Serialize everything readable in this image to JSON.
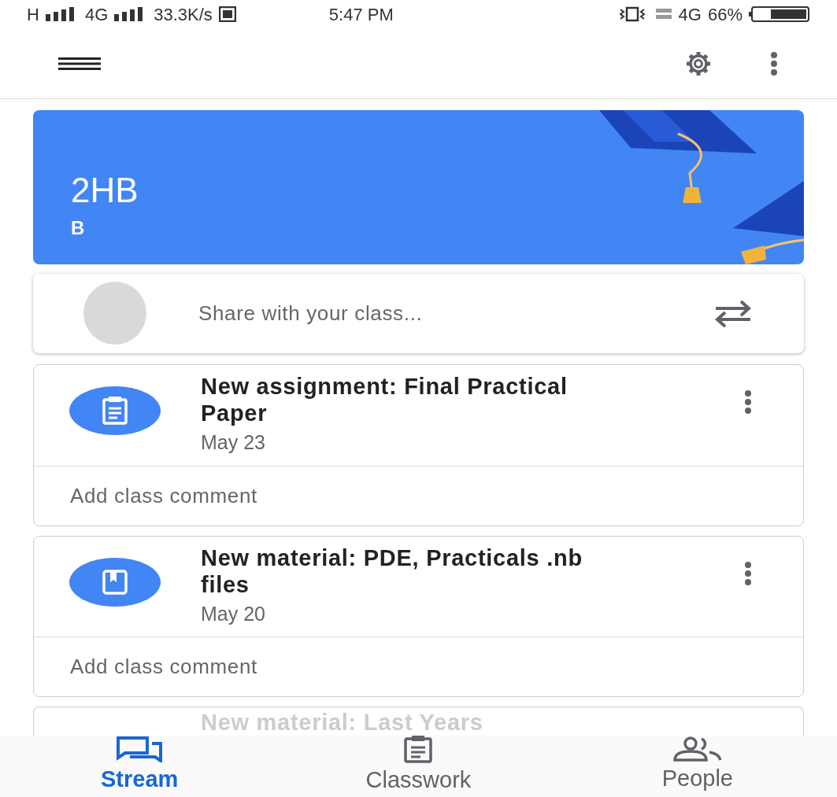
{
  "status_bar": {
    "network_1": "H",
    "network_2": "4G",
    "speed": "33.3K/s",
    "time": "5:47 PM",
    "network_3": "4G",
    "battery": "66%"
  },
  "class_banner": {
    "title": "2HB",
    "section": "B"
  },
  "share": {
    "placeholder": "Share with your class..."
  },
  "posts": [
    {
      "kind": "assignment",
      "title": "New assignment: Final Practical Paper",
      "date": "May 23",
      "comment_placeholder": "Add class comment"
    },
    {
      "kind": "material",
      "title": "New material: PDE, Practicals .nb files",
      "date": "May 20",
      "comment_placeholder": "Add class comment"
    },
    {
      "title": "New material: Last Years"
    }
  ],
  "bottom_nav": [
    {
      "label": "Stream",
      "selected": true
    },
    {
      "label": "Classwork",
      "selected": false
    },
    {
      "label": "People",
      "selected": false
    }
  ]
}
